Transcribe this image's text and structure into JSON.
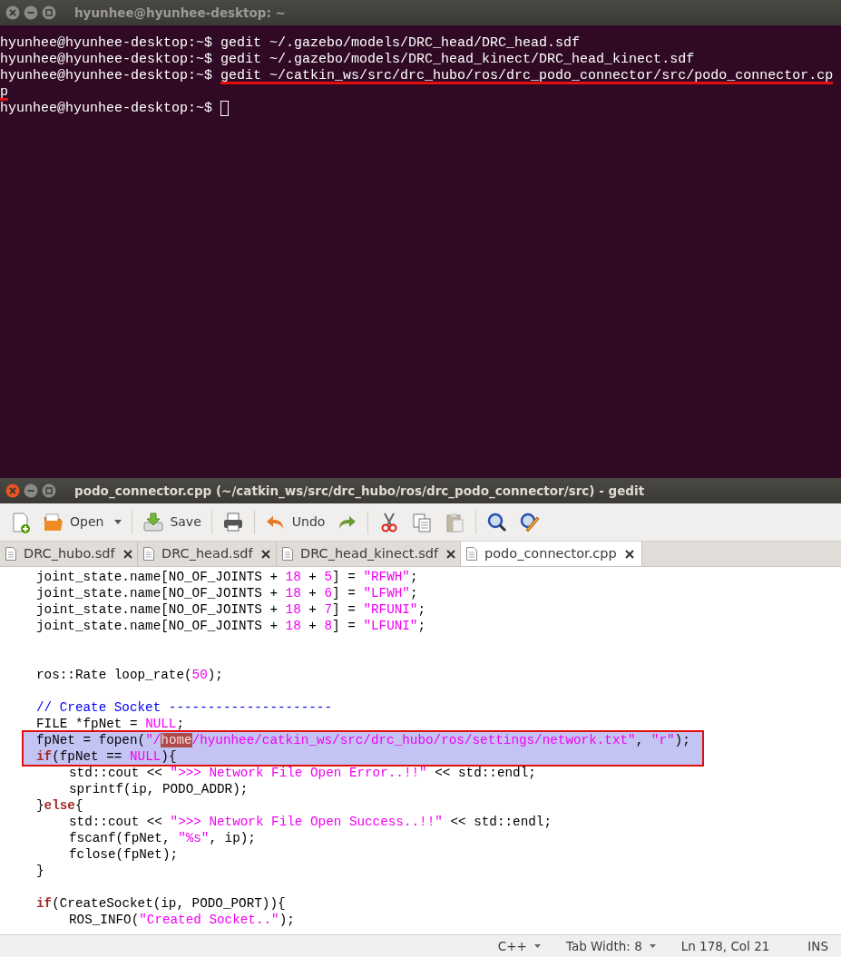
{
  "terminal": {
    "title": "hyunhee@hyunhee-desktop: ~",
    "lines": [
      {
        "prompt": "hyunhee@hyunhee-desktop:~$",
        "command": "gedit ~/.gazebo/models/DRC_head/DRC_head.sdf",
        "underlined": false
      },
      {
        "prompt": "hyunhee@hyunhee-desktop:~$",
        "command": "gedit ~/.gazebo/models/DRC_head_kinect/DRC_head_kinect.sdf",
        "underlined": false
      },
      {
        "prompt": "hyunhee@hyunhee-desktop:~$",
        "command": "gedit ~/catkin_ws/src/drc_hubo/ros/drc_podo_connector/src/podo_connector.cp",
        "underlined": true
      },
      {
        "command": "p",
        "underlined": true
      },
      {
        "prompt": "hyunhee@hyunhee-desktop:~$",
        "cursor": true,
        "underlined": false
      }
    ]
  },
  "editor": {
    "title": "podo_connector.cpp (~/catkin_ws/src/drc_hubo/ros/drc_podo_connector/src) - gedit",
    "toolbar": [
      {
        "kind": "new",
        "disabled": false
      },
      {
        "kind": "open",
        "label": "Open",
        "disabled": false
      },
      {
        "kind": "dropdown",
        "disabled": false
      },
      {
        "kind": "save",
        "label": "Save",
        "disabled": false
      },
      {
        "kind": "print",
        "disabled": false
      },
      {
        "kind": "undo",
        "label": "Undo",
        "disabled": false
      },
      {
        "kind": "redo",
        "disabled": false
      },
      {
        "kind": "cut",
        "disabled": false
      },
      {
        "kind": "copy",
        "disabled": false
      },
      {
        "kind": "paste",
        "disabled": true
      },
      {
        "kind": "find",
        "disabled": false
      },
      {
        "kind": "replace",
        "disabled": false
      }
    ],
    "tabs": [
      {
        "label": "DRC_hubo.sdf",
        "selected": false
      },
      {
        "label": "DRC_head.sdf",
        "selected": false
      },
      {
        "label": "DRC_head_kinect.sdf",
        "selected": false
      },
      {
        "label": "podo_connector.cpp",
        "selected": true
      }
    ],
    "code_lines": [
      {
        "kind": "indent1",
        "selected": false,
        "boxed": false,
        "tokens": [
          {
            "kind": "plain",
            "text": "joint_state.name[NO_OF_JOINTS + "
          },
          {
            "kind": "number",
            "text": "18"
          },
          {
            "kind": "plain",
            "text": " + "
          },
          {
            "kind": "number",
            "text": "5"
          },
          {
            "kind": "plain",
            "text": "] = "
          },
          {
            "kind": "string",
            "text": "\"RFWH\""
          },
          {
            "kind": "plain",
            "text": ";"
          }
        ]
      },
      {
        "kind": "indent1",
        "selected": false,
        "boxed": false,
        "tokens": [
          {
            "kind": "plain",
            "text": "joint_state.name[NO_OF_JOINTS + "
          },
          {
            "kind": "number",
            "text": "18"
          },
          {
            "kind": "plain",
            "text": " + "
          },
          {
            "kind": "number",
            "text": "6"
          },
          {
            "kind": "plain",
            "text": "] = "
          },
          {
            "kind": "string",
            "text": "\"LFWH\""
          },
          {
            "kind": "plain",
            "text": ";"
          }
        ]
      },
      {
        "kind": "indent1",
        "selected": false,
        "boxed": false,
        "tokens": [
          {
            "kind": "plain",
            "text": "joint_state.name[NO_OF_JOINTS + "
          },
          {
            "kind": "number",
            "text": "18"
          },
          {
            "kind": "plain",
            "text": " + "
          },
          {
            "kind": "number",
            "text": "7"
          },
          {
            "kind": "plain",
            "text": "] = "
          },
          {
            "kind": "string",
            "text": "\"RFUNI\""
          },
          {
            "kind": "plain",
            "text": ";"
          }
        ]
      },
      {
        "kind": "indent1",
        "selected": false,
        "boxed": false,
        "tokens": [
          {
            "kind": "plain",
            "text": "joint_state.name[NO_OF_JOINTS + "
          },
          {
            "kind": "number",
            "text": "18"
          },
          {
            "kind": "plain",
            "text": " + "
          },
          {
            "kind": "number",
            "text": "8"
          },
          {
            "kind": "plain",
            "text": "] = "
          },
          {
            "kind": "string",
            "text": "\"LFUNI\""
          },
          {
            "kind": "plain",
            "text": ";"
          }
        ]
      },
      {
        "kind": "blank"
      },
      {
        "kind": "blank"
      },
      {
        "kind": "indent1",
        "selected": false,
        "boxed": false,
        "tokens": [
          {
            "kind": "plain",
            "text": "ros::Rate loop_rate("
          },
          {
            "kind": "number",
            "text": "50"
          },
          {
            "kind": "plain",
            "text": ");"
          }
        ]
      },
      {
        "kind": "blank"
      },
      {
        "kind": "indent1",
        "selected": false,
        "boxed": false,
        "tokens": [
          {
            "kind": "comment",
            "text": "// Create Socket ---------------------"
          }
        ]
      },
      {
        "kind": "indent1",
        "selected": false,
        "boxed": false,
        "tokens": [
          {
            "kind": "plain",
            "text": "FILE *fpNet = "
          },
          {
            "kind": "constant",
            "text": "NULL"
          },
          {
            "kind": "plain",
            "text": ";"
          }
        ]
      },
      {
        "kind": "indent1",
        "selected": true,
        "boxed": true,
        "tokens": [
          {
            "kind": "plain",
            "text": "fpNet = fopen("
          },
          {
            "kind": "string",
            "text": "\"/"
          },
          {
            "kind": "match",
            "text": "home"
          },
          {
            "kind": "string",
            "text": "/hyunhee/catkin_ws/src/drc_hubo/ros/settings/network.txt\""
          },
          {
            "kind": "plain",
            "text": ", "
          },
          {
            "kind": "string",
            "text": "\"r\""
          },
          {
            "kind": "plain",
            "text": ");"
          }
        ]
      },
      {
        "kind": "indent1",
        "selected": true,
        "boxed": true,
        "tokens": [
          {
            "kind": "keyword",
            "text": "if"
          },
          {
            "kind": "plain",
            "text": "(fpNet == "
          },
          {
            "kind": "constant",
            "text": "NULL"
          },
          {
            "kind": "plain",
            "text": "){"
          }
        ]
      },
      {
        "kind": "indent2",
        "selected": false,
        "boxed": false,
        "tokens": [
          {
            "kind": "plain",
            "text": "std::cout << "
          },
          {
            "kind": "string",
            "text": "\">>> Network File Open Error..!!\""
          },
          {
            "kind": "plain",
            "text": " << std::endl;"
          }
        ]
      },
      {
        "kind": "indent2",
        "selected": false,
        "boxed": false,
        "tokens": [
          {
            "kind": "plain",
            "text": "sprintf(ip, PODO_ADDR);"
          }
        ]
      },
      {
        "kind": "indent1",
        "selected": false,
        "boxed": false,
        "tokens": [
          {
            "kind": "plain",
            "text": "}"
          },
          {
            "kind": "keyword",
            "text": "else"
          },
          {
            "kind": "plain",
            "text": "{"
          }
        ]
      },
      {
        "kind": "indent2",
        "selected": false,
        "boxed": false,
        "tokens": [
          {
            "kind": "plain",
            "text": "std::cout << "
          },
          {
            "kind": "string",
            "text": "\">>> Network File Open Success..!!\""
          },
          {
            "kind": "plain",
            "text": " << std::endl;"
          }
        ]
      },
      {
        "kind": "indent2",
        "selected": false,
        "boxed": false,
        "tokens": [
          {
            "kind": "plain",
            "text": "fscanf(fpNet, "
          },
          {
            "kind": "string",
            "text": "\"%s\""
          },
          {
            "kind": "plain",
            "text": ", ip);"
          }
        ]
      },
      {
        "kind": "indent2",
        "selected": false,
        "boxed": false,
        "tokens": [
          {
            "kind": "plain",
            "text": "fclose(fpNet);"
          }
        ]
      },
      {
        "kind": "indent1",
        "selected": false,
        "boxed": false,
        "tokens": [
          {
            "kind": "plain",
            "text": "}"
          }
        ]
      },
      {
        "kind": "blank"
      },
      {
        "kind": "indent1",
        "selected": false,
        "boxed": false,
        "tokens": [
          {
            "kind": "keyword",
            "text": "if"
          },
          {
            "kind": "plain",
            "text": "(CreateSocket(ip, PODO_PORT)){"
          }
        ]
      },
      {
        "kind": "indent2",
        "selected": false,
        "boxed": false,
        "tokens": [
          {
            "kind": "plain",
            "text": "ROS_INFO("
          },
          {
            "kind": "string",
            "text": "\"Created Socket..\""
          },
          {
            "kind": "plain",
            "text": ");"
          }
        ]
      }
    ],
    "status_bar": [
      {
        "kind": "menu",
        "text": "C++"
      },
      {
        "kind": "menu",
        "text": "Tab Width: 8"
      },
      {
        "kind": "text",
        "text": "Ln 178, Col 21"
      },
      {
        "kind": "text",
        "text": "INS"
      }
    ]
  }
}
